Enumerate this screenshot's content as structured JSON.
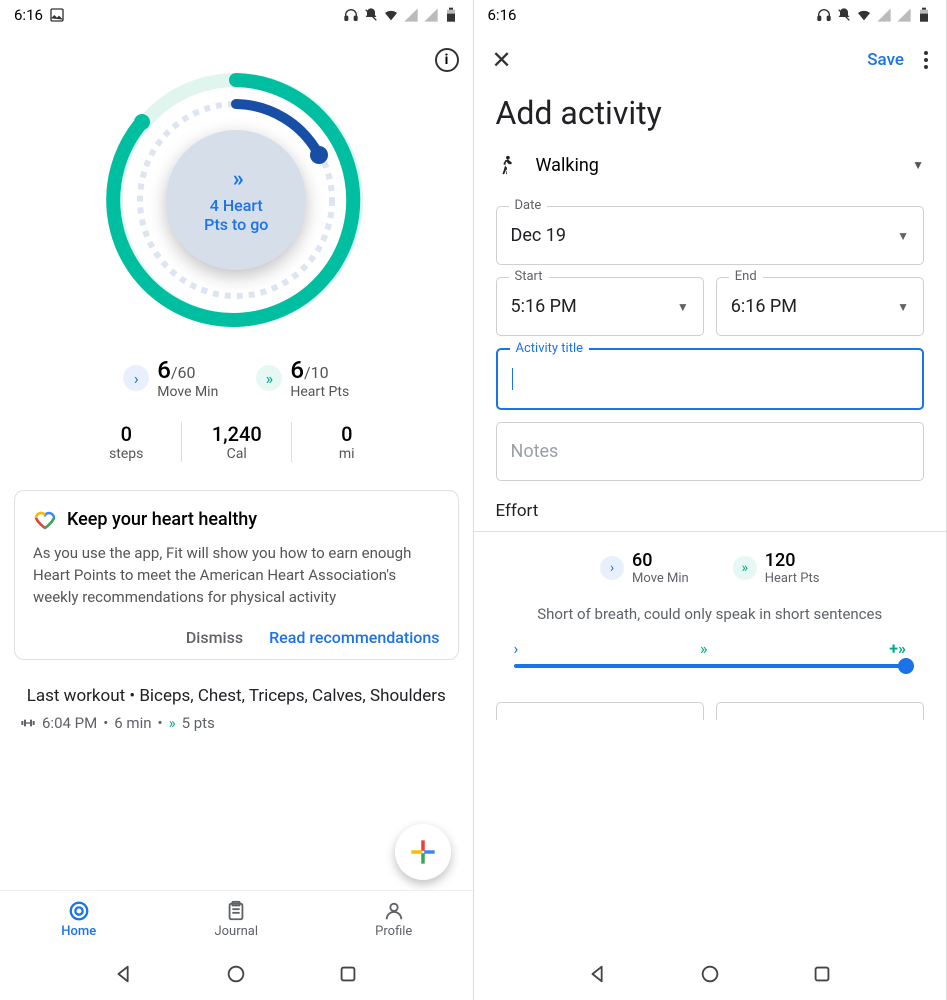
{
  "status": {
    "time": "6:16"
  },
  "left": {
    "center": {
      "line1": "4 Heart",
      "line2": "Pts to go"
    },
    "move": {
      "value": "6",
      "goal": "/60",
      "label": "Move Min"
    },
    "heart": {
      "value": "6",
      "goal": "/10",
      "label": "Heart Pts"
    },
    "stats": {
      "steps": {
        "value": "0",
        "unit": "steps"
      },
      "cal": {
        "value": "1,240",
        "unit": "Cal"
      },
      "mi": {
        "value": "0",
        "unit": "mi"
      }
    },
    "card": {
      "title": "Keep your heart healthy",
      "body": "As you use the app, Fit will show you how to earn enough Heart Points to meet the American Heart Association's weekly recommendations for physical activity",
      "dismiss": "Dismiss",
      "read": "Read recommendations"
    },
    "workout": {
      "title": "Last workout • Biceps, Chest, Triceps, Calves, Shoulders",
      "time": "6:04 PM",
      "duration": "6 min",
      "pts": "5 pts"
    },
    "nav": {
      "home": "Home",
      "journal": "Journal",
      "profile": "Profile"
    }
  },
  "right": {
    "save": "Save",
    "title": "Add activity",
    "activity": "Walking",
    "date": {
      "label": "Date",
      "value": "Dec 19"
    },
    "start": {
      "label": "Start",
      "value": "5:16 PM"
    },
    "end": {
      "label": "End",
      "value": "6:16 PM"
    },
    "actTitle": {
      "label": "Activity title"
    },
    "notes": {
      "placeholder": "Notes"
    },
    "effort": {
      "label": "Effort",
      "move": {
        "value": "60",
        "label": "Move Min"
      },
      "heart": {
        "value": "120",
        "label": "Heart Pts"
      },
      "desc": "Short of breath, could only speak in short sentences"
    }
  }
}
